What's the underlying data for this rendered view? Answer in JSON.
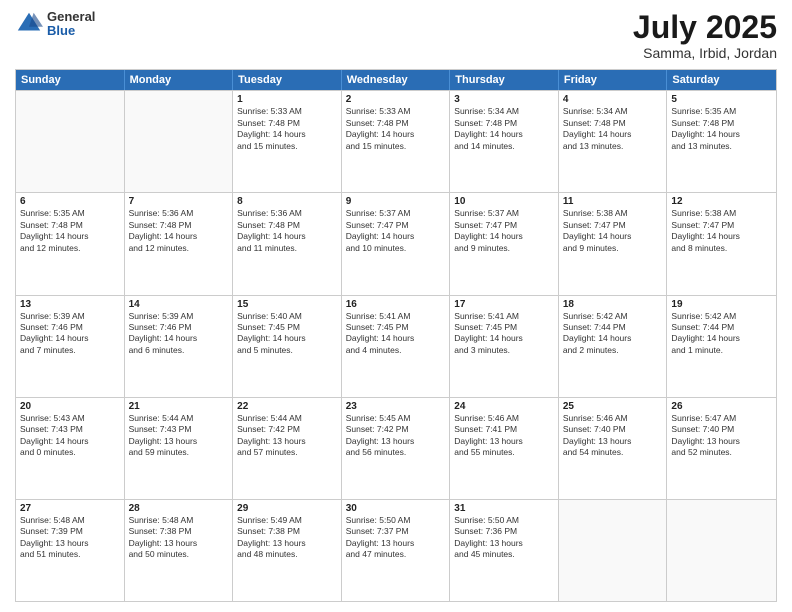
{
  "header": {
    "logo_general": "General",
    "logo_blue": "Blue",
    "month_title": "July 2025",
    "location": "Samma, Irbid, Jordan"
  },
  "days_of_week": [
    "Sunday",
    "Monday",
    "Tuesday",
    "Wednesday",
    "Thursday",
    "Friday",
    "Saturday"
  ],
  "weeks": [
    [
      {
        "day": "",
        "info": [],
        "empty": true
      },
      {
        "day": "",
        "info": [],
        "empty": true
      },
      {
        "day": "1",
        "info": [
          "Sunrise: 5:33 AM",
          "Sunset: 7:48 PM",
          "Daylight: 14 hours",
          "and 15 minutes."
        ]
      },
      {
        "day": "2",
        "info": [
          "Sunrise: 5:33 AM",
          "Sunset: 7:48 PM",
          "Daylight: 14 hours",
          "and 15 minutes."
        ]
      },
      {
        "day": "3",
        "info": [
          "Sunrise: 5:34 AM",
          "Sunset: 7:48 PM",
          "Daylight: 14 hours",
          "and 14 minutes."
        ]
      },
      {
        "day": "4",
        "info": [
          "Sunrise: 5:34 AM",
          "Sunset: 7:48 PM",
          "Daylight: 14 hours",
          "and 13 minutes."
        ]
      },
      {
        "day": "5",
        "info": [
          "Sunrise: 5:35 AM",
          "Sunset: 7:48 PM",
          "Daylight: 14 hours",
          "and 13 minutes."
        ]
      }
    ],
    [
      {
        "day": "6",
        "info": [
          "Sunrise: 5:35 AM",
          "Sunset: 7:48 PM",
          "Daylight: 14 hours",
          "and 12 minutes."
        ]
      },
      {
        "day": "7",
        "info": [
          "Sunrise: 5:36 AM",
          "Sunset: 7:48 PM",
          "Daylight: 14 hours",
          "and 12 minutes."
        ]
      },
      {
        "day": "8",
        "info": [
          "Sunrise: 5:36 AM",
          "Sunset: 7:48 PM",
          "Daylight: 14 hours",
          "and 11 minutes."
        ]
      },
      {
        "day": "9",
        "info": [
          "Sunrise: 5:37 AM",
          "Sunset: 7:47 PM",
          "Daylight: 14 hours",
          "and 10 minutes."
        ]
      },
      {
        "day": "10",
        "info": [
          "Sunrise: 5:37 AM",
          "Sunset: 7:47 PM",
          "Daylight: 14 hours",
          "and 9 minutes."
        ]
      },
      {
        "day": "11",
        "info": [
          "Sunrise: 5:38 AM",
          "Sunset: 7:47 PM",
          "Daylight: 14 hours",
          "and 9 minutes."
        ]
      },
      {
        "day": "12",
        "info": [
          "Sunrise: 5:38 AM",
          "Sunset: 7:47 PM",
          "Daylight: 14 hours",
          "and 8 minutes."
        ]
      }
    ],
    [
      {
        "day": "13",
        "info": [
          "Sunrise: 5:39 AM",
          "Sunset: 7:46 PM",
          "Daylight: 14 hours",
          "and 7 minutes."
        ]
      },
      {
        "day": "14",
        "info": [
          "Sunrise: 5:39 AM",
          "Sunset: 7:46 PM",
          "Daylight: 14 hours",
          "and 6 minutes."
        ]
      },
      {
        "day": "15",
        "info": [
          "Sunrise: 5:40 AM",
          "Sunset: 7:45 PM",
          "Daylight: 14 hours",
          "and 5 minutes."
        ]
      },
      {
        "day": "16",
        "info": [
          "Sunrise: 5:41 AM",
          "Sunset: 7:45 PM",
          "Daylight: 14 hours",
          "and 4 minutes."
        ]
      },
      {
        "day": "17",
        "info": [
          "Sunrise: 5:41 AM",
          "Sunset: 7:45 PM",
          "Daylight: 14 hours",
          "and 3 minutes."
        ]
      },
      {
        "day": "18",
        "info": [
          "Sunrise: 5:42 AM",
          "Sunset: 7:44 PM",
          "Daylight: 14 hours",
          "and 2 minutes."
        ]
      },
      {
        "day": "19",
        "info": [
          "Sunrise: 5:42 AM",
          "Sunset: 7:44 PM",
          "Daylight: 14 hours",
          "and 1 minute."
        ]
      }
    ],
    [
      {
        "day": "20",
        "info": [
          "Sunrise: 5:43 AM",
          "Sunset: 7:43 PM",
          "Daylight: 14 hours",
          "and 0 minutes."
        ]
      },
      {
        "day": "21",
        "info": [
          "Sunrise: 5:44 AM",
          "Sunset: 7:43 PM",
          "Daylight: 13 hours",
          "and 59 minutes."
        ]
      },
      {
        "day": "22",
        "info": [
          "Sunrise: 5:44 AM",
          "Sunset: 7:42 PM",
          "Daylight: 13 hours",
          "and 57 minutes."
        ]
      },
      {
        "day": "23",
        "info": [
          "Sunrise: 5:45 AM",
          "Sunset: 7:42 PM",
          "Daylight: 13 hours",
          "and 56 minutes."
        ]
      },
      {
        "day": "24",
        "info": [
          "Sunrise: 5:46 AM",
          "Sunset: 7:41 PM",
          "Daylight: 13 hours",
          "and 55 minutes."
        ]
      },
      {
        "day": "25",
        "info": [
          "Sunrise: 5:46 AM",
          "Sunset: 7:40 PM",
          "Daylight: 13 hours",
          "and 54 minutes."
        ]
      },
      {
        "day": "26",
        "info": [
          "Sunrise: 5:47 AM",
          "Sunset: 7:40 PM",
          "Daylight: 13 hours",
          "and 52 minutes."
        ]
      }
    ],
    [
      {
        "day": "27",
        "info": [
          "Sunrise: 5:48 AM",
          "Sunset: 7:39 PM",
          "Daylight: 13 hours",
          "and 51 minutes."
        ]
      },
      {
        "day": "28",
        "info": [
          "Sunrise: 5:48 AM",
          "Sunset: 7:38 PM",
          "Daylight: 13 hours",
          "and 50 minutes."
        ]
      },
      {
        "day": "29",
        "info": [
          "Sunrise: 5:49 AM",
          "Sunset: 7:38 PM",
          "Daylight: 13 hours",
          "and 48 minutes."
        ]
      },
      {
        "day": "30",
        "info": [
          "Sunrise: 5:50 AM",
          "Sunset: 7:37 PM",
          "Daylight: 13 hours",
          "and 47 minutes."
        ]
      },
      {
        "day": "31",
        "info": [
          "Sunrise: 5:50 AM",
          "Sunset: 7:36 PM",
          "Daylight: 13 hours",
          "and 45 minutes."
        ]
      },
      {
        "day": "",
        "info": [],
        "empty": true
      },
      {
        "day": "",
        "info": [],
        "empty": true
      }
    ]
  ]
}
